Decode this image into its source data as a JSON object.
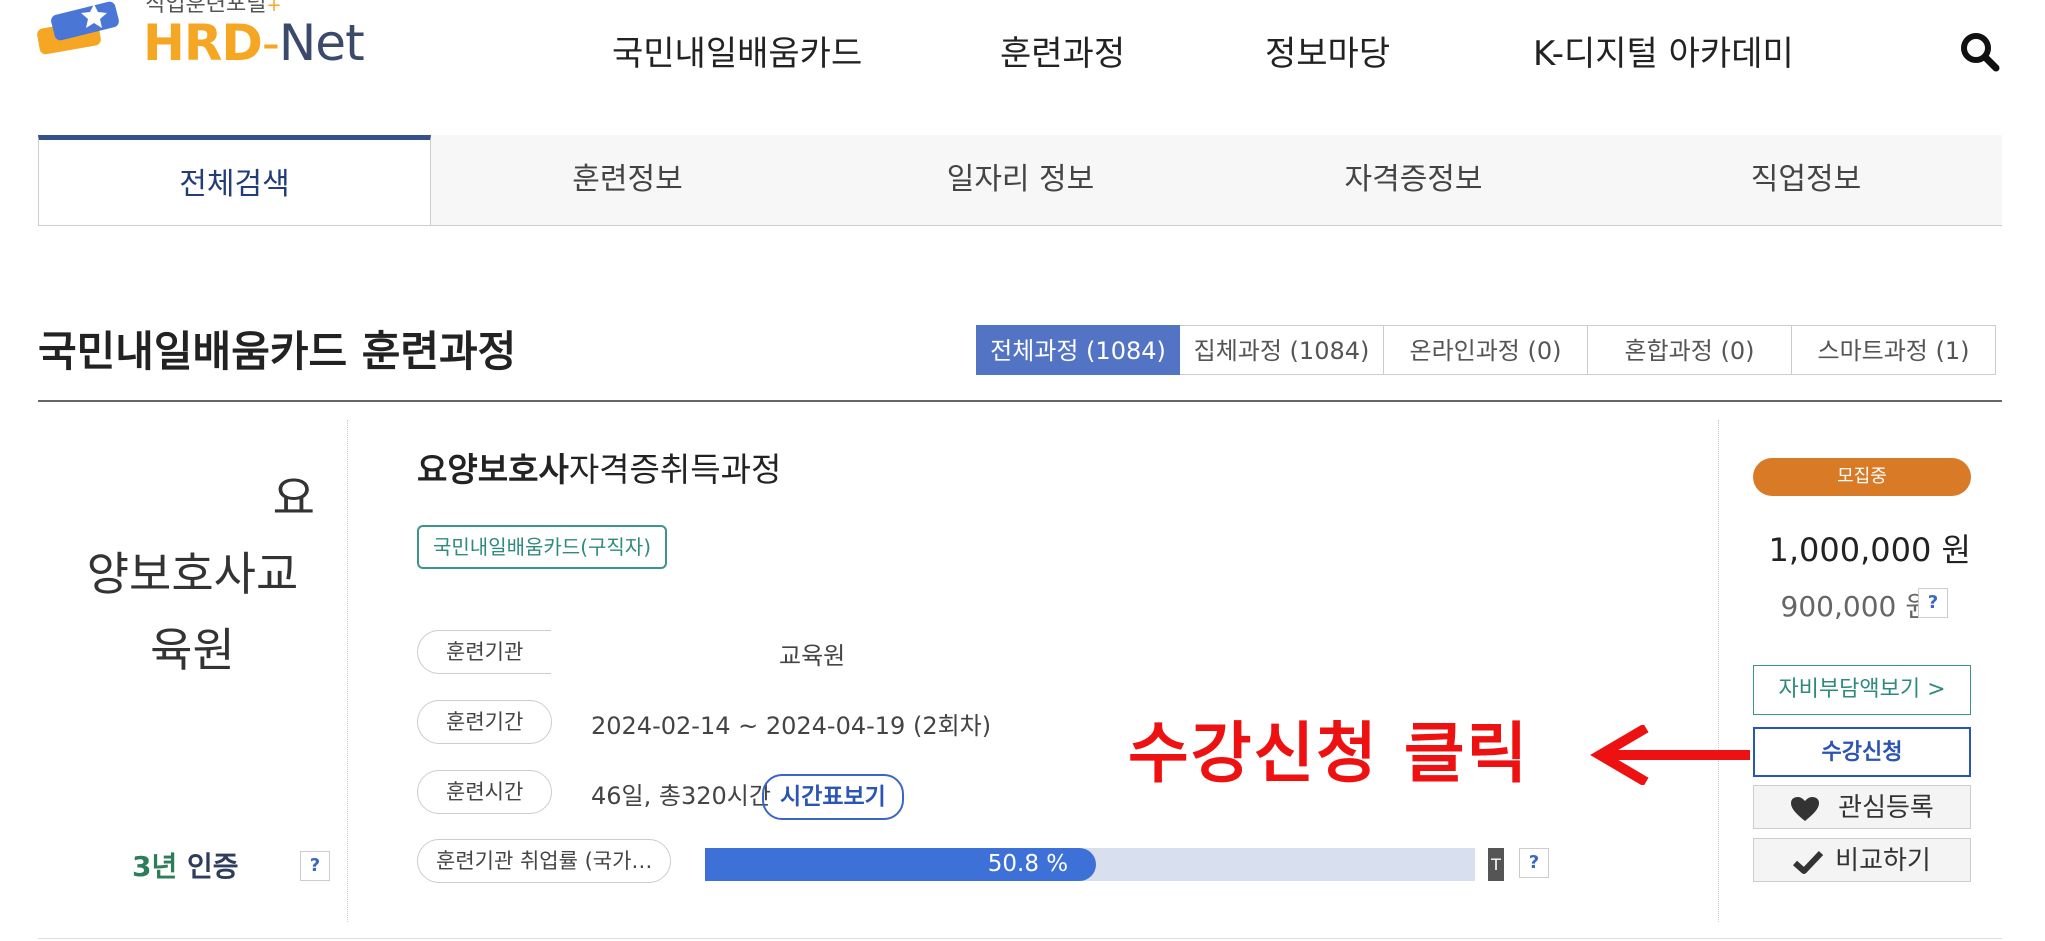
{
  "header": {
    "logo_subtitle": "직업훈련포털",
    "logo_hrd": "HRD",
    "logo_dash": "-",
    "logo_net": "Net",
    "nav": [
      "국민내일배움카드",
      "훈련과정",
      "정보마당",
      "K-디지털 아카데미"
    ]
  },
  "tabs": [
    "전체검색",
    "훈련정보",
    "일자리 정보",
    "자격증정보",
    "직업정보"
  ],
  "section": {
    "title": "국민내일배움카드 훈련과정",
    "filters": [
      "전체과정 (1084)",
      "집체과정 (1084)",
      "온라인과정 (0)",
      "혼합과정 (0)",
      "스마트과정 (1)"
    ]
  },
  "course": {
    "institution_lines": [
      "요",
      "양보호사교",
      "육원"
    ],
    "cert_years": "3년",
    "cert_label": "인증",
    "title_bold": "요양보호사",
    "title_rest": "자격증취득과정",
    "card_badge": "국민내일배움카드(구직자)",
    "org_label": "훈련기관",
    "org_value": "교육원",
    "period_label": "훈련기간",
    "period_value": "2024-02-14 ~ 2024-04-19 (2회차)",
    "time_label": "훈련시간",
    "time_value": "46일, 총320시간",
    "timetable_button": "시간표보기",
    "employment_label": "훈련기관 취업률 (국가…",
    "employment_rate_text": "50.8 %",
    "employment_rate": 50.8,
    "t_icon_label": "T",
    "help": "?"
  },
  "side": {
    "status": "모집중",
    "price": "1,000,000 원",
    "price_support": "900,000 원",
    "self_pay_button": "자비부담액보기 >",
    "apply_button": "수강신청",
    "favorite_button": "관심등록",
    "compare_button": "비교하기"
  },
  "annotation": {
    "text": "수강신청 클릭",
    "color": "#ee1111"
  },
  "colors": {
    "primary": "#3d71d8",
    "tab_active": "#35508c",
    "badge_green": "#3d9488",
    "status_orange": "#d97b26"
  }
}
